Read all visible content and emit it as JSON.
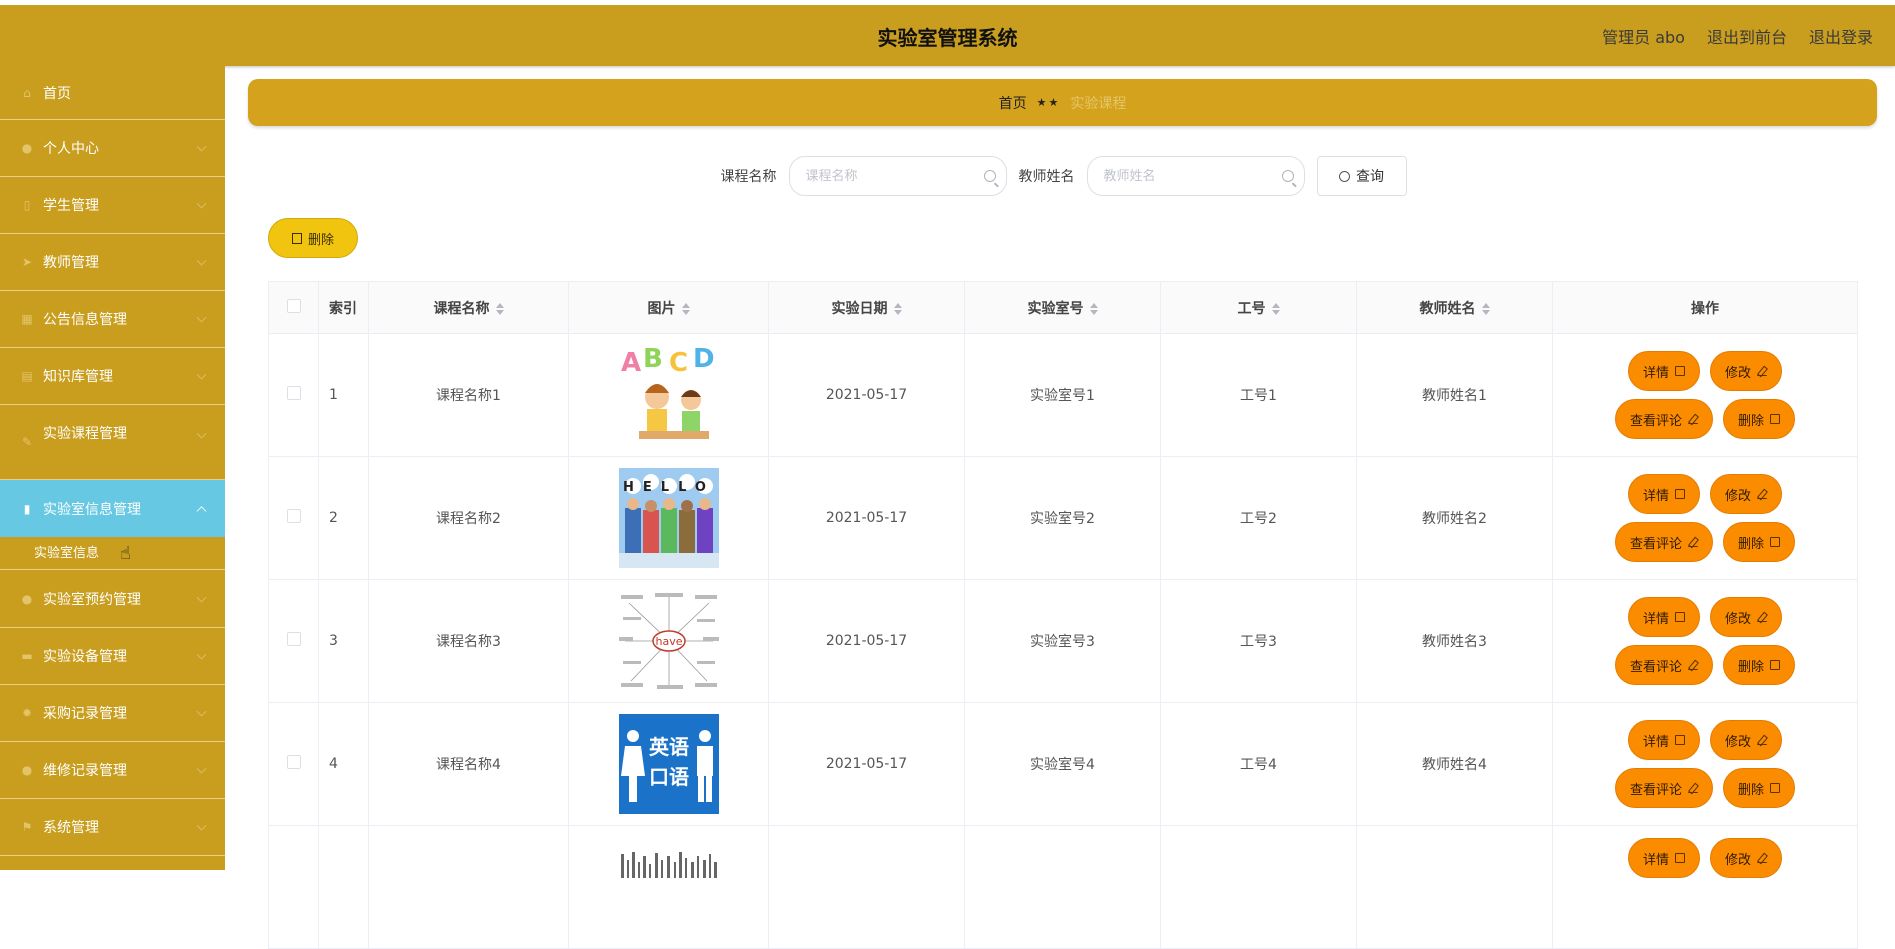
{
  "header": {
    "title": "实验室管理系统",
    "admin": "管理员 abo",
    "to_front": "退出到前台",
    "logout": "退出登录"
  },
  "sidebar": {
    "items": [
      {
        "label": "首页",
        "icon": "home-icon"
      },
      {
        "label": "个人中心",
        "icon": "user-icon"
      },
      {
        "label": "学生管理",
        "icon": "document-icon"
      },
      {
        "label": "教师管理",
        "icon": "send-icon"
      },
      {
        "label": "公告信息管理",
        "icon": "table-icon"
      },
      {
        "label": "知识库管理",
        "icon": "clipboard-icon"
      },
      {
        "label": "实验课程管理",
        "icon": "edit-icon"
      },
      {
        "label": "实验室信息管理",
        "icon": "bar-chart-icon"
      },
      {
        "label": "实验室预约管理",
        "icon": "person-icon"
      },
      {
        "label": "实验设备管理",
        "icon": "briefcase-icon"
      },
      {
        "label": "采购记录管理",
        "icon": "gear-icon"
      },
      {
        "label": "维修记录管理",
        "icon": "user-icon"
      },
      {
        "label": "系统管理",
        "icon": "flag-icon"
      }
    ],
    "submenu": "实验室信息"
  },
  "breadcrumb": {
    "home": "首页",
    "separator": "★★",
    "current": "实验课程"
  },
  "search": {
    "course_label": "课程名称",
    "course_placeholder": "课程名称",
    "teacher_label": "教师姓名",
    "teacher_placeholder": "教师姓名",
    "query_button": "查询"
  },
  "toolbar": {
    "delete_label": "删除"
  },
  "table": {
    "headers": {
      "index": "索引",
      "course": "课程名称",
      "image": "图片",
      "date": "实验日期",
      "room": "实验室号",
      "work_no": "工号",
      "teacher": "教师姓名",
      "ops": "操作"
    },
    "rows": [
      {
        "index": "1",
        "course": "课程名称1",
        "date": "2021-05-17",
        "room": "实验室号1",
        "work_no": "工号1",
        "teacher": "教师姓名1"
      },
      {
        "index": "2",
        "course": "课程名称2",
        "date": "2021-05-17",
        "room": "实验室号2",
        "work_no": "工号2",
        "teacher": "教师姓名2"
      },
      {
        "index": "3",
        "course": "课程名称3",
        "date": "2021-05-17",
        "room": "实验室号3",
        "work_no": "工号3",
        "teacher": "教师姓名3"
      },
      {
        "index": "4",
        "course": "课程名称4",
        "date": "2021-05-17",
        "room": "实验室号4",
        "work_no": "工号4",
        "teacher": "教师姓名4"
      }
    ],
    "ops": {
      "detail": "详情",
      "edit": "修改",
      "comments": "查看评论",
      "delete": "删除"
    }
  },
  "images": {
    "img2_text": "HELLO",
    "img3_text": "have",
    "img4_line1": "英语",
    "img4_line2": "口语"
  },
  "colors": {
    "header_bg": "#c99e1e",
    "active_menu": "#66c8e2",
    "op_button": "#fb8c00",
    "delete_button": "#f1c40f"
  }
}
